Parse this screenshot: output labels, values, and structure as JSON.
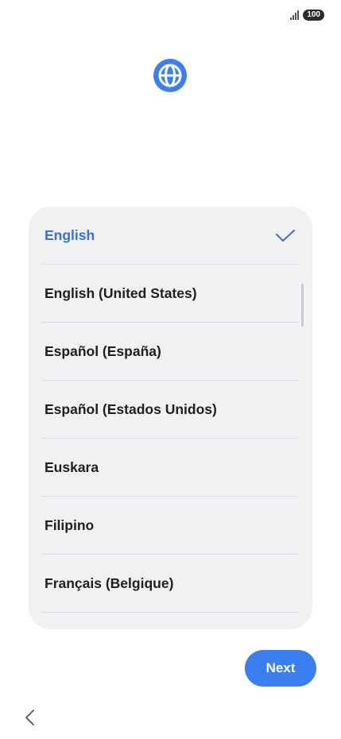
{
  "status_bar": {
    "battery": "100",
    "signal_icon": "signal-icon"
  },
  "header": {
    "icon": "globe-icon",
    "accent_color": "#3a7ef0"
  },
  "language_list": {
    "items": [
      {
        "label": "English",
        "selected": true
      },
      {
        "label": "English (United States)",
        "selected": false
      },
      {
        "label": "Español (España)",
        "selected": false
      },
      {
        "label": "Español (Estados Unidos)",
        "selected": false
      },
      {
        "label": "Euskara",
        "selected": false
      },
      {
        "label": "Filipino",
        "selected": false
      },
      {
        "label": "Français (Belgique)",
        "selected": false
      }
    ],
    "selected_color": "#3a6fd8"
  },
  "actions": {
    "next_label": "Next",
    "back_icon": "chevron-left-icon"
  }
}
